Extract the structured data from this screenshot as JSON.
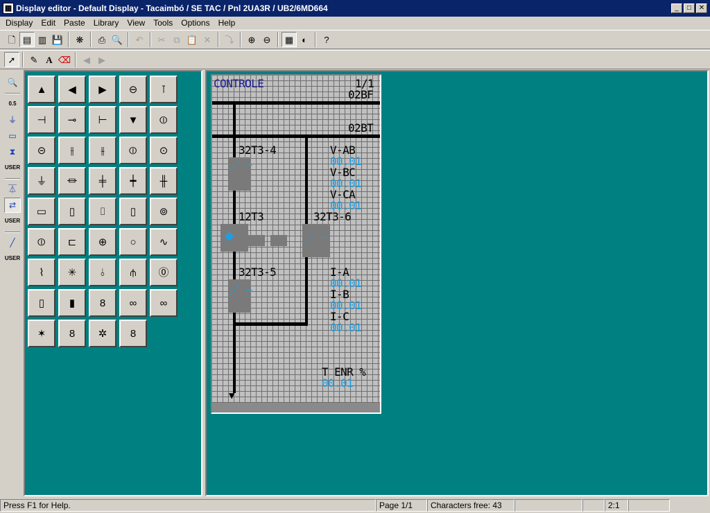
{
  "window": {
    "title": "Display editor - Default Display - Tacaimbó / SE TAC / Pnl 2UA3R / UB2/6MD664",
    "minimize": "_",
    "maximize": "□",
    "close": "✕"
  },
  "menu": {
    "display": "Display",
    "edit": "Edit",
    "paste": "Paste",
    "library": "Library",
    "view": "View",
    "tools": "Tools",
    "options": "Options",
    "help": "Help"
  },
  "toolbar": {
    "buttons": [
      "new-icon",
      "default-display-icon",
      "control-display-icon",
      "save-icon",
      "symbol-library-icon",
      "print-icon",
      "print-preview-icon",
      "undo-icon",
      "cut-icon",
      "copy-icon",
      "paste-icon",
      "delete-icon",
      "lower-icon",
      "zoom-in-icon",
      "zoom-out-icon",
      "grid-icon",
      "contrast-icon",
      "context-help-icon"
    ]
  },
  "toolbar2": {
    "buttons": [
      "select-pointer-icon",
      "pencil-icon",
      "text-tool-icon",
      "eraser-icon",
      "prev-page-icon",
      "next-page-icon"
    ]
  },
  "lcd": {
    "header": "CONTROLE",
    "page": "1/1",
    "bay1": "02BF",
    "bay2": "02BT",
    "dev1": "32T3-4",
    "dev2": "12T3",
    "dev3": "32T3-6",
    "dev4": "32T3-5",
    "m_vab": "V-AB",
    "m_vbc": "V-BC",
    "m_vca": "V-CA",
    "m_ia": "I-A",
    "m_ib": "I-B",
    "m_ic": "I-C",
    "m_tenr": "T ENR %",
    "val": "00.01"
  },
  "status": {
    "help": "Press F1 for Help.",
    "page": "Page 1/1",
    "chars": "Characters free: 43",
    "zoom": "2:1",
    "empty": ""
  }
}
